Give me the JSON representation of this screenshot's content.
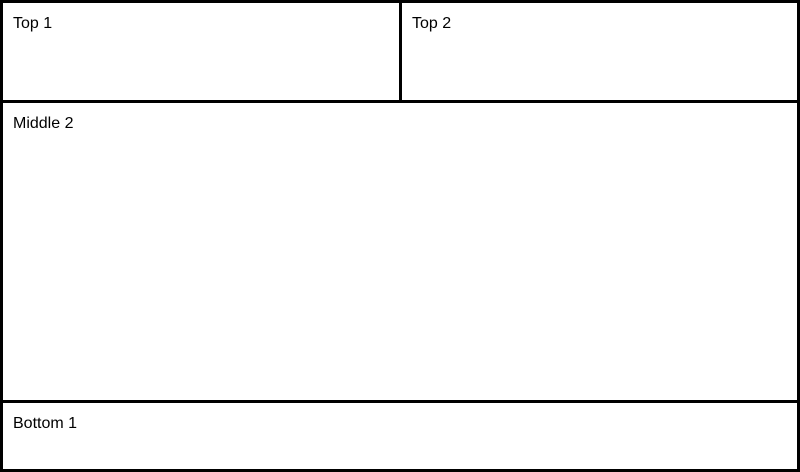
{
  "panels": {
    "top_1": {
      "label": "Top 1"
    },
    "top_2": {
      "label": "Top 2"
    },
    "middle_2": {
      "label": "Middle 2"
    },
    "bottom_1": {
      "label": "Bottom 1"
    }
  },
  "colors": {
    "border": "#000000",
    "background": "#ffffff",
    "text": "#000000"
  }
}
